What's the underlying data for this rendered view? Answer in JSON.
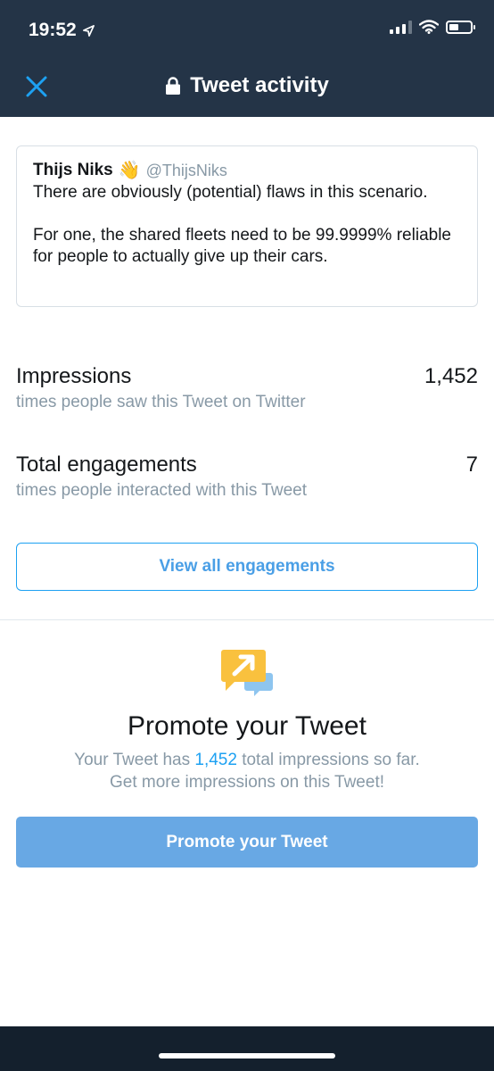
{
  "status_bar": {
    "time": "19:52",
    "icons": [
      "location-arrow-icon",
      "signal-icon",
      "wifi-icon",
      "battery-icon"
    ]
  },
  "nav": {
    "title": "Tweet activity",
    "close_icon": "close-icon",
    "lock_icon": "lock-icon"
  },
  "tweet": {
    "name": "Thijs Niks",
    "emoji": "👋",
    "handle": "@ThijsNiks",
    "text": "There are obviously (potential) flaws in this scenario.\n\nFor one, the shared fleets need to be 99.9999% reliable for people to actually give up their cars."
  },
  "metrics": [
    {
      "label": "Impressions",
      "sub": "times people saw this Tweet on Twitter",
      "value": "1,452"
    },
    {
      "label": "Total engagements",
      "sub": "times people interacted with this Tweet",
      "value": "7"
    }
  ],
  "view_all_label": "View all engagements",
  "promote": {
    "title": "Promote your Tweet",
    "desc_prefix": "Your Tweet has ",
    "desc_count": "1,452",
    "desc_suffix": " total impressions so far.",
    "desc_line2": "Get more impressions on this Tweet!",
    "button_label": "Promote your Tweet"
  },
  "colors": {
    "header_bg": "#243447",
    "accent": "#1da1f2",
    "button_fill": "#68a8e4",
    "muted": "#8899a6"
  }
}
